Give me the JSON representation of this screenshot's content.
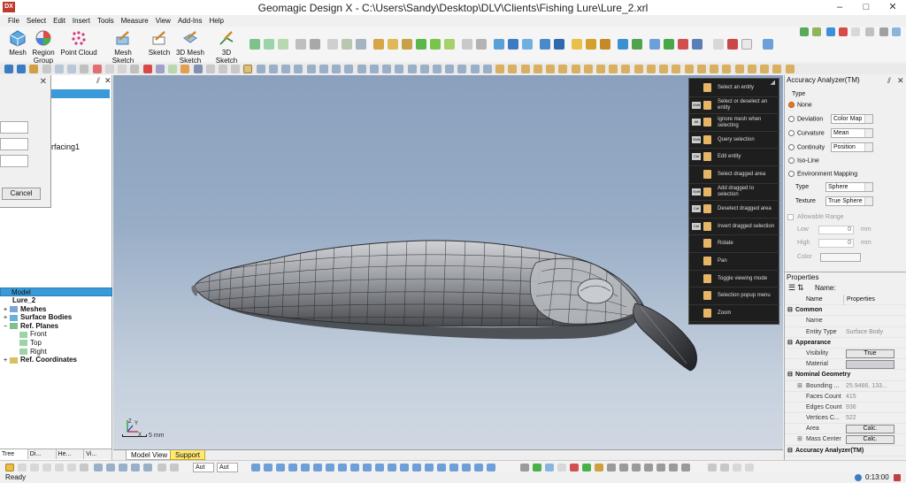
{
  "window": {
    "logo": "DX",
    "title": "Geomagic Design X - C:\\Users\\Sandy\\Desktop\\DLV\\Clients\\Fishing Lure\\Lure_2.xrl",
    "min": "–",
    "max": "□",
    "close": "✕"
  },
  "menu": [
    "File",
    "Select",
    "Edit",
    "Insert",
    "Tools",
    "Measure",
    "View",
    "Add-Ins",
    "Help"
  ],
  "ribbon": {
    "mesh": "Mesh",
    "region_group": "Region Group",
    "point_cloud": "Point Cloud",
    "mesh_sketch": "Mesh Sketch",
    "sketch": "Sketch",
    "mesh_sketch_3d": "3D Mesh Sketch",
    "sketch_3d": "3D Sketch"
  },
  "dialog": {
    "close": "✕",
    "cancel": "Cancel",
    "surfacing_text": "rfacing1"
  },
  "tree": {
    "header": "Model",
    "items": [
      {
        "label": "Lure_2"
      },
      {
        "label": "Meshes"
      },
      {
        "label": "Surface Bodies"
      },
      {
        "label": "Ref. Planes"
      },
      {
        "label": "Front"
      },
      {
        "label": "Top"
      },
      {
        "label": "Right"
      },
      {
        "label": "Ref. Coordinates"
      }
    ],
    "toggles": {
      "expand": "+",
      "collapse": "−"
    }
  },
  "left_tabs": [
    "Tree",
    "Di...",
    "He...",
    "Vi..."
  ],
  "viewport": {
    "scale": "5 mm",
    "tabs": [
      "Model View",
      "Support"
    ],
    "axes": {
      "x": "X",
      "y": "Y",
      "z": "Z"
    }
  },
  "selection_popup": {
    "items": [
      {
        "key": "",
        "label": "Select an entity"
      },
      {
        "key": "Shift",
        "label": "Select or deselect an entity"
      },
      {
        "key": "Alt",
        "label": "Ignore mesh when selecting"
      },
      {
        "key": "Shift",
        "label": "Query selection"
      },
      {
        "key": "Ctrl",
        "label": "Edit entity"
      },
      {
        "key": "",
        "label": "Select dragged area"
      },
      {
        "key": "Shift",
        "label": "Add dragged to selection"
      },
      {
        "key": "Ctrl",
        "label": "Deselect dragged area"
      },
      {
        "key": "Ctrl",
        "label": "Invert dragged selection"
      },
      {
        "key": "",
        "label": "Rotate"
      },
      {
        "key": "",
        "label": "Pan"
      },
      {
        "key": "",
        "label": "Toggle viewing mode"
      },
      {
        "key": "",
        "label": "Selection popup menu"
      },
      {
        "key": "",
        "label": "Zoom"
      }
    ]
  },
  "accuracy": {
    "title": "Accuracy Analyzer(TM)",
    "type_label": "Type",
    "none": "None",
    "deviation": "Deviation",
    "deviation_value": "Color Map",
    "curvature": "Curvature",
    "curvature_value": "Mean",
    "continuity": "Continuity",
    "continuity_value": "Position",
    "isoline": "Iso-Line",
    "env": "Environment Mapping",
    "type2": "Type",
    "type2_value": "Sphere",
    "texture": "Texture",
    "texture_value": "True Sphere",
    "allowable": "Allowable Range",
    "low": "Low",
    "low_value": "0",
    "high": "High",
    "high_value": "0",
    "unit": "mm",
    "color": "Color"
  },
  "properties": {
    "title": "Properties",
    "name_label": "Name:",
    "col_name": "Name",
    "col_props": "Properties",
    "common": "Common",
    "name": "Name",
    "entity_type": "Entity Type",
    "entity_type_value": "Surface Body",
    "appearance": "Appearance",
    "visibility": "Visibility",
    "visibility_value": "True",
    "material": "Material",
    "nominal": "Nominal Geometry",
    "bounding": "Bounding ...",
    "bounding_value": "25.9466, 133...",
    "faces": "Faces Count",
    "faces_value": "415",
    "edges": "Edges Count",
    "edges_value": "936",
    "vertices": "Vertices C...",
    "vertices_value": "522",
    "area": "Area",
    "area_value": "Calc.",
    "mass": "Mass Center",
    "mass_value": "Calc.",
    "footer": "Accuracy Analyzer(TM)"
  },
  "bottom": {
    "auto1": "Aut",
    "auto2": "Aut"
  },
  "status": {
    "ready": "Ready",
    "time": "0:13:00"
  }
}
